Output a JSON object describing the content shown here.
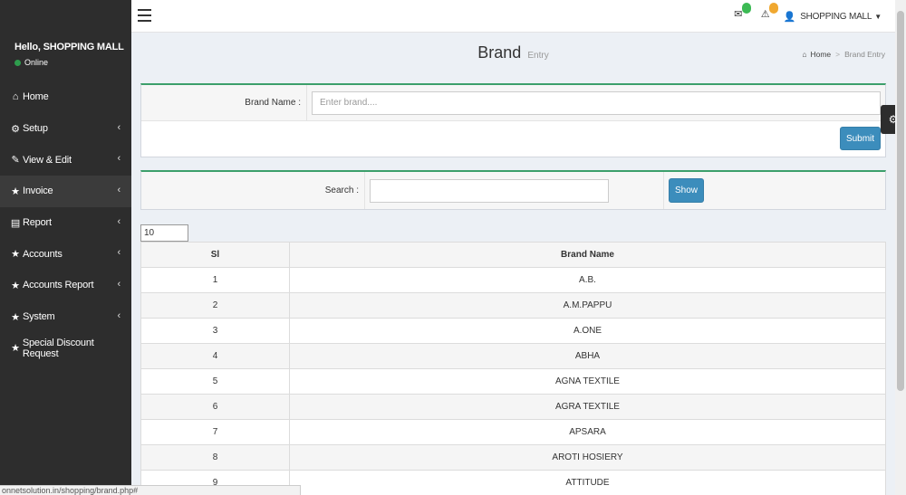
{
  "sidebar": {
    "greeting": "Hello, SHOPPING MALL",
    "status": "Online",
    "items": [
      {
        "label": "Home",
        "icon": "home-icon",
        "glyph": "⌂"
      },
      {
        "label": "Setup",
        "icon": "cogs-icon",
        "glyph": "⚙"
      },
      {
        "label": "View & Edit",
        "icon": "edit-icon",
        "glyph": "✎"
      },
      {
        "label": "Invoice",
        "icon": "star-icon",
        "glyph": "★"
      },
      {
        "label": "Report",
        "icon": "file-icon",
        "glyph": "▤"
      },
      {
        "label": "Accounts",
        "icon": "star-icon",
        "glyph": "★"
      },
      {
        "label": "Accounts Report",
        "icon": "star-icon",
        "glyph": "★"
      },
      {
        "label": "System",
        "icon": "star-icon",
        "glyph": "★"
      },
      {
        "label": "Special Discount Request",
        "icon": "star-icon",
        "glyph": "★"
      }
    ]
  },
  "topbar": {
    "user": "SHOPPING MALL",
    "mail_icon": "envelope-icon",
    "alert_icon": "warning-icon",
    "badge_colors": {
      "mail": "#3cba54",
      "alert": "#f0a830"
    }
  },
  "header": {
    "title": "Brand",
    "subtitle": "Entry",
    "breadcrumb": {
      "home": "Home",
      "current": "Brand Entry"
    }
  },
  "form": {
    "brand_label": "Brand Name :",
    "brand_placeholder": "Enter brand....",
    "submit_label": "Submit"
  },
  "search": {
    "label": "Search :",
    "value": "",
    "show_label": "Show"
  },
  "page_length": "10",
  "table": {
    "headers": [
      "Sl",
      "Brand Name"
    ],
    "rows": [
      [
        "1",
        "A.B."
      ],
      [
        "2",
        "A.M.PAPPU"
      ],
      [
        "3",
        "A.ONE"
      ],
      [
        "4",
        "ABHA"
      ],
      [
        "5",
        "AGNA TEXTILE"
      ],
      [
        "6",
        "AGRA TEXTILE"
      ],
      [
        "7",
        "APSARA"
      ],
      [
        "8",
        "AROTI HOSIERY"
      ],
      [
        "9",
        "ATTITUDE"
      ]
    ]
  },
  "status_url": "onnetsolution.in/shopping/brand.php#",
  "colors": {
    "sidebar_bg": "#2d2d2d",
    "accent_border": "#3c9f6b",
    "button": "#3c8dbc"
  }
}
